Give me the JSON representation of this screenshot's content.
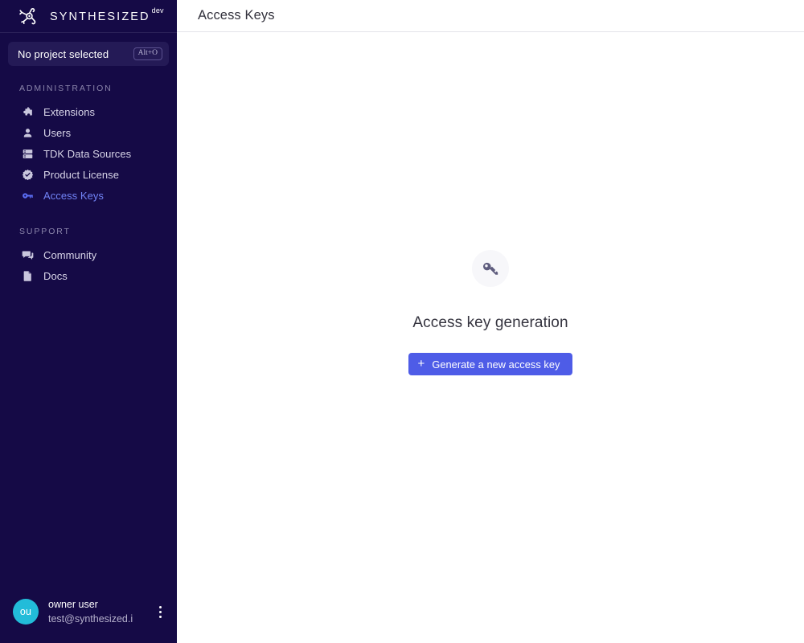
{
  "sidebar": {
    "brand": {
      "wordmark": "SYNTHESIZED",
      "superscript": "dev",
      "logo_icon": "network-graph-logo-icon"
    },
    "project_selector": {
      "label": "No project selected",
      "shortcut": "Alt+O"
    },
    "sections": [
      {
        "heading": "ADMINISTRATION",
        "items": [
          {
            "label": "Extensions",
            "icon": "puzzle-piece-icon",
            "active": false
          },
          {
            "label": "Users",
            "icon": "person-icon",
            "active": false
          },
          {
            "label": "TDK Data Sources",
            "icon": "server-icon",
            "active": false
          },
          {
            "label": "Product License",
            "icon": "verified-badge-icon",
            "active": false
          },
          {
            "label": "Access Keys",
            "icon": "key-icon",
            "active": true
          }
        ]
      },
      {
        "heading": "SUPPORT",
        "items": [
          {
            "label": "Community",
            "icon": "chat-bubble-icon",
            "active": false
          },
          {
            "label": "Docs",
            "icon": "document-icon",
            "active": false
          }
        ]
      }
    ],
    "user": {
      "initials": "ou",
      "name": "owner user",
      "email": "test@synthesized.i",
      "menu_icon": "kebab-menu-icon"
    }
  },
  "header": {
    "title": "Access Keys"
  },
  "main": {
    "empty_state": {
      "icon": "key-icon",
      "title": "Access key generation",
      "button_label": "Generate a new access key",
      "button_icon": "plus-icon"
    }
  },
  "colors": {
    "sidebar_bg": "#150a46",
    "project_chip_bg": "#241a56",
    "accent_button": "#4e5ce7",
    "active_nav": "#7183f6",
    "avatar_bg": "#22bcd9",
    "header_border": "#e3e3ea",
    "empty_icon_bg": "#f7f7fa"
  }
}
